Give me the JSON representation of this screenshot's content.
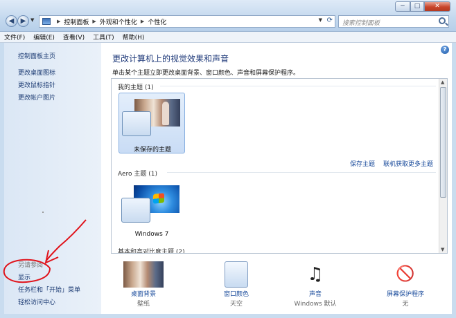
{
  "window": {
    "controls": {
      "minimize": "─",
      "maximize": "□",
      "close": "✕"
    }
  },
  "address_bar": {
    "segments": [
      "控制面板",
      "外观和个性化",
      "个性化"
    ]
  },
  "search": {
    "placeholder": "搜索控制面板"
  },
  "menu": [
    "文件(F)",
    "编辑(E)",
    "查看(V)",
    "工具(T)",
    "帮助(H)"
  ],
  "sidebar": {
    "links": [
      "控制面板主页",
      "更改桌面图标",
      "更改鼠标指针",
      "更改帐户图片"
    ],
    "see_also": "另请参阅",
    "bottom_links": [
      "显示",
      "任务栏和「开始」菜单",
      "轻松访问中心"
    ]
  },
  "main": {
    "title": "更改计算机上的视觉效果和声音",
    "description": "单击某个主题立即更改桌面背景、窗口颜色、声音和屏幕保护程序。",
    "my_themes_heading": "我的主题 (1)",
    "unsaved_theme": "未保存的主题",
    "save_theme": "保存主题",
    "get_more_themes": "联机获取更多主题",
    "aero_heading": "Aero 主题 (1)",
    "windows7_theme": "Windows 7",
    "basic_heading": "基本和高对比度主题 (2)"
  },
  "shortcuts": [
    {
      "label": "桌面背景",
      "sub": "壁纸",
      "icon": "wallpaper-icon"
    },
    {
      "label": "窗口颜色",
      "sub": "天空",
      "icon": "window-color-icon"
    },
    {
      "label": "声音",
      "sub": "Windows 默认",
      "icon": "sound-icon"
    },
    {
      "label": "屏幕保护程序",
      "sub": "无",
      "icon": "screensaver-icon"
    }
  ],
  "colors": {
    "link": "#1b4c9c",
    "title": "#1f3a7a",
    "annotation": "#e0131b"
  }
}
